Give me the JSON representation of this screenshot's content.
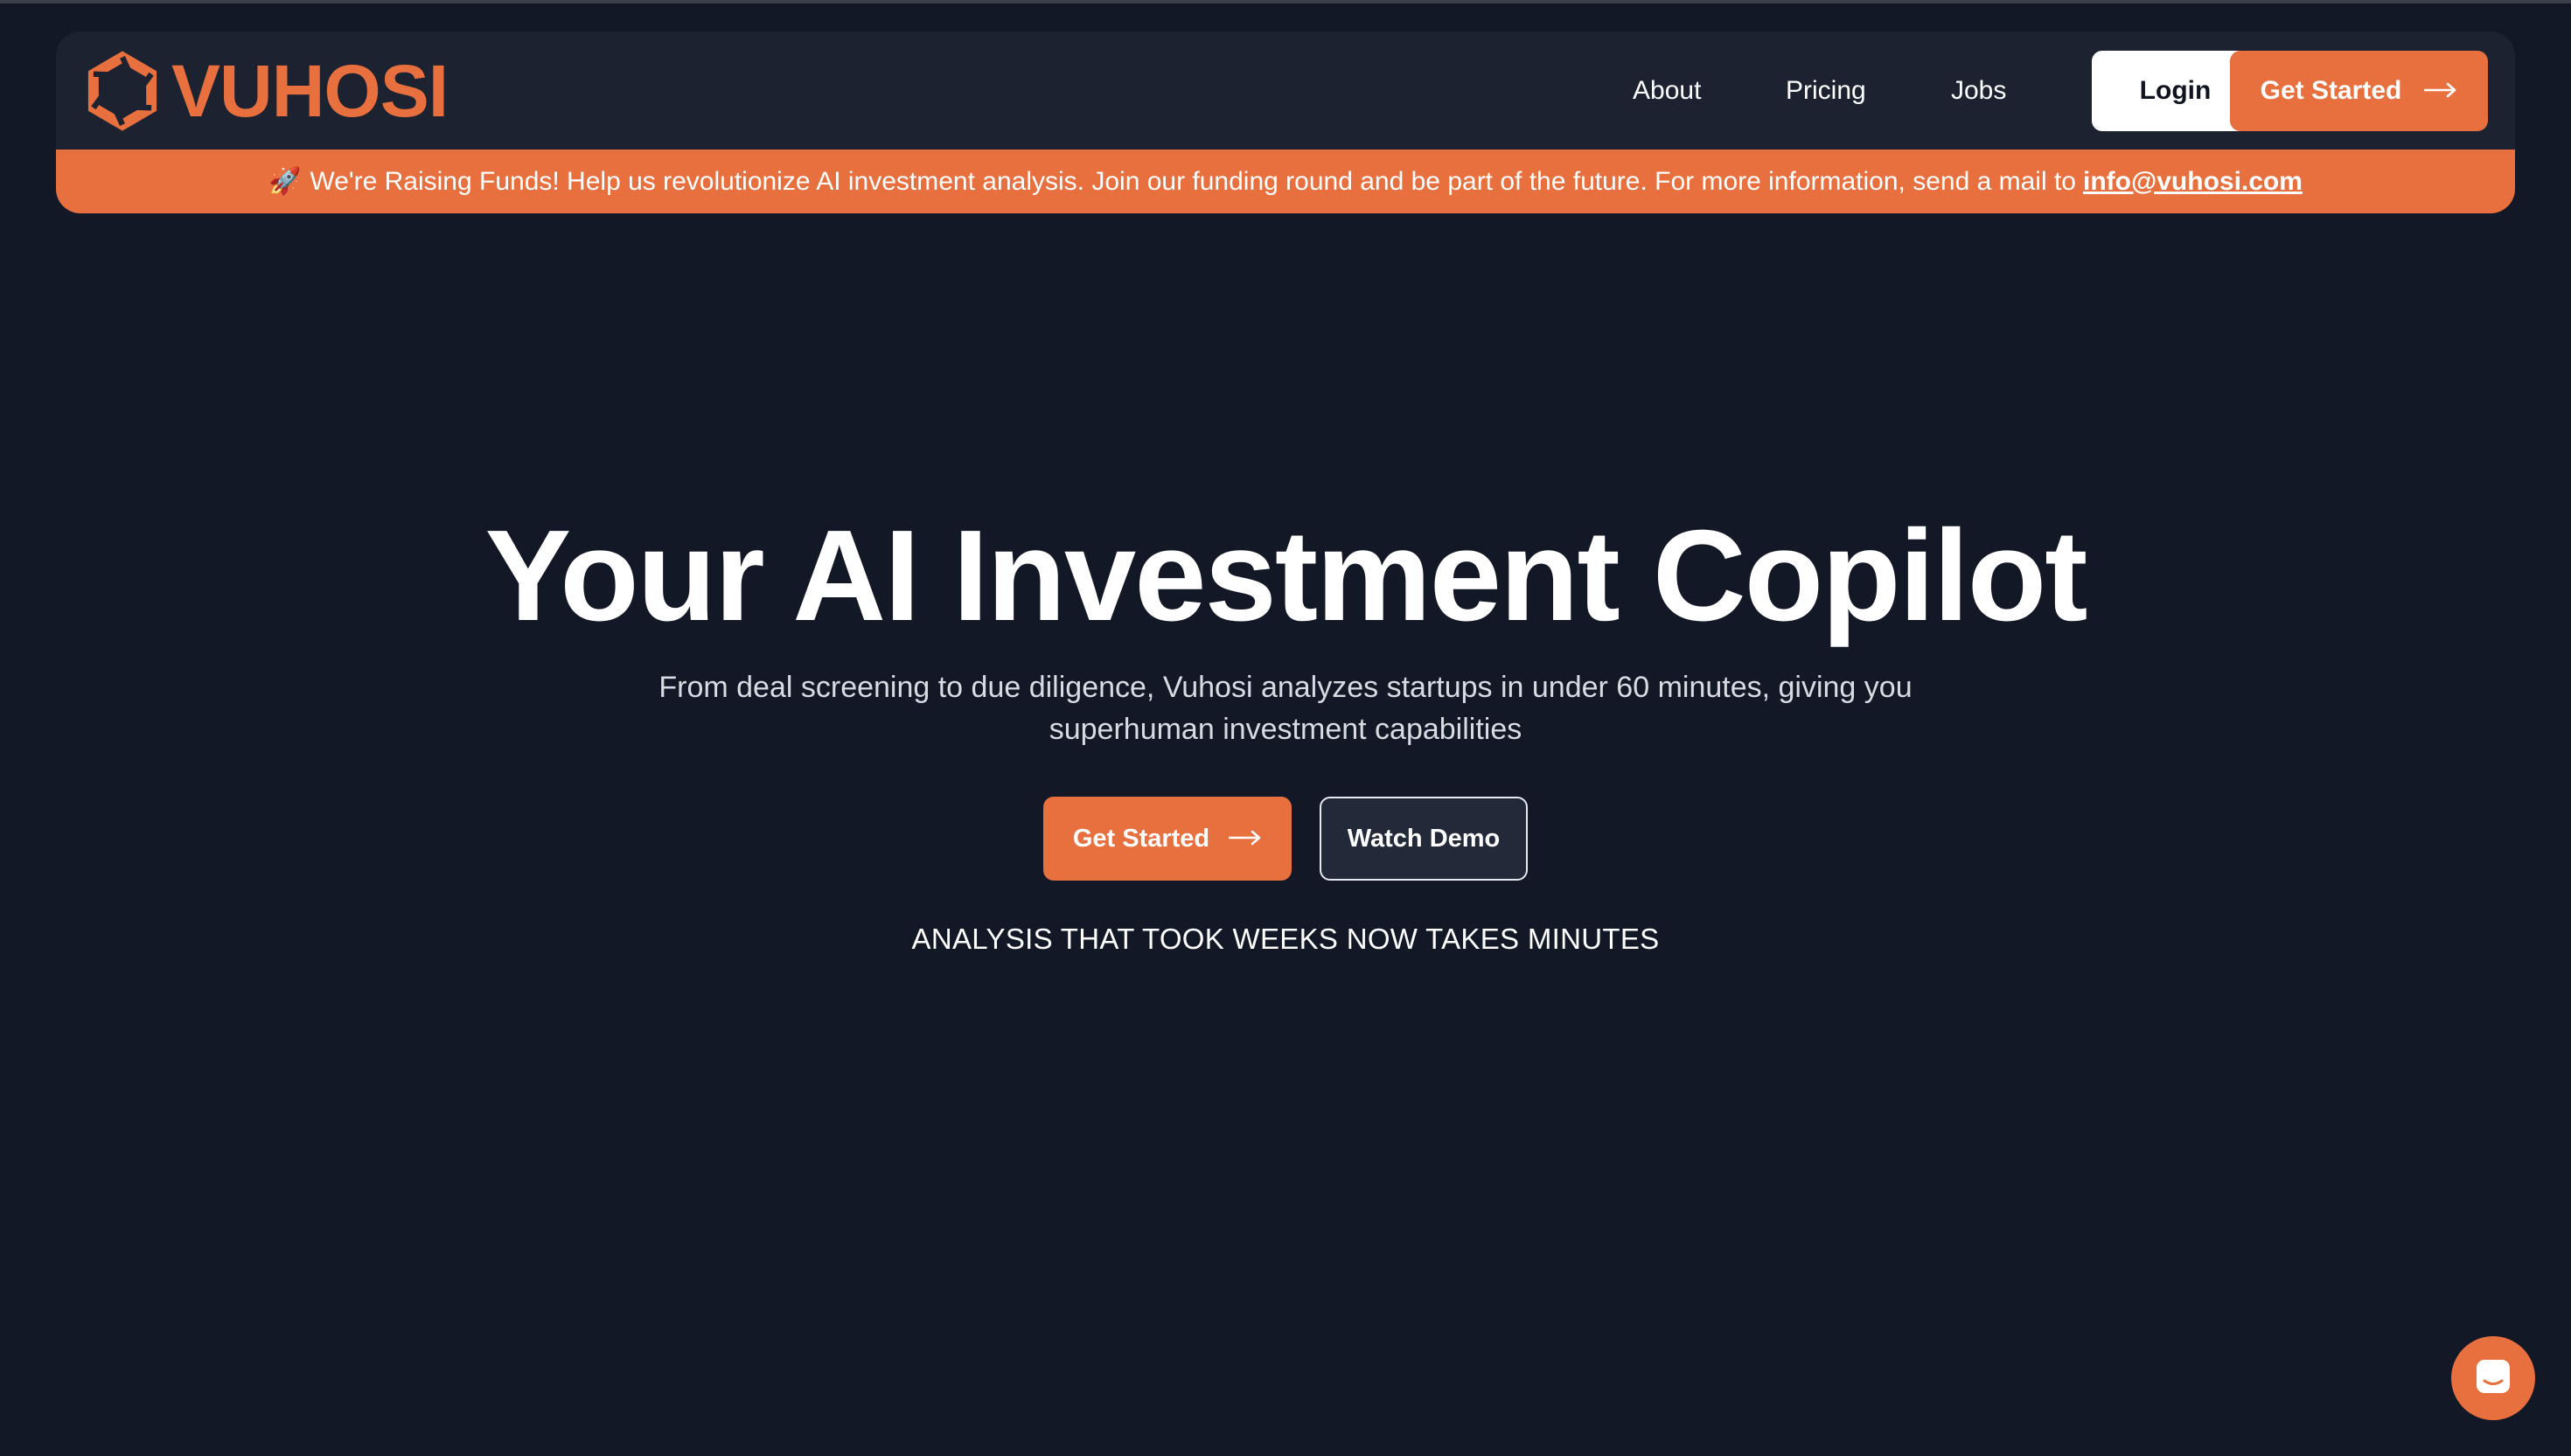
{
  "brand": {
    "name": "VUHOSI",
    "accent_color": "#e8703f",
    "background_color": "#121826",
    "logo_icon": "hexagon-aperture-icon"
  },
  "nav": {
    "links": [
      "About",
      "Pricing",
      "Jobs"
    ],
    "login_label": "Login",
    "get_started_label": "Get Started",
    "arrow_icon": "arrow-right-icon"
  },
  "banner": {
    "icon": "rocket-icon",
    "emoji": "🚀",
    "text": "We're Raising Funds! Help us revolutionize AI investment analysis. Join our funding round and be part of the future. For more information, send a mail to",
    "email": "info@vuhosi.com"
  },
  "hero": {
    "title": "Your AI Investment Copilot",
    "subtitle_line1": "From deal screening to due diligence, Vuhosi analyzes startups in under 60 minutes, giving you",
    "subtitle_line2": "superhuman investment capabilities",
    "get_started_label": "Get Started",
    "watch_demo_label": "Watch Demo",
    "tagline": "ANALYSIS THAT TOOK WEEKS NOW TAKES MINUTES"
  },
  "chat_widget": {
    "icon": "chat-bubble-icon"
  }
}
